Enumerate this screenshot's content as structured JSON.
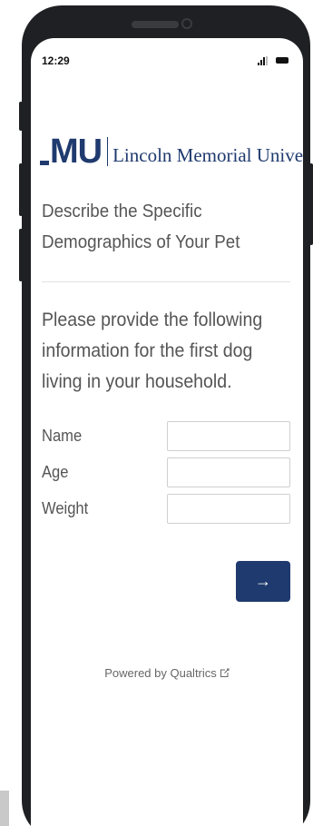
{
  "status_bar": {
    "time": "12:29"
  },
  "logo": {
    "mark": "MU",
    "name": "Lincoln Memorial Universit"
  },
  "survey": {
    "heading": "Describe the Specific Demographics of Your Pet",
    "question": "Please provide the following information for the first dog living in your household.",
    "fields": [
      {
        "label": "Name",
        "value": ""
      },
      {
        "label": "Age",
        "value": ""
      },
      {
        "label": "Weight",
        "value": ""
      }
    ],
    "next_label": "→"
  },
  "footer": {
    "powered_by": "Powered by Qualtrics"
  },
  "colors": {
    "brand": "#1f3a6e",
    "text": "#555555",
    "frame": "#1f2023"
  }
}
